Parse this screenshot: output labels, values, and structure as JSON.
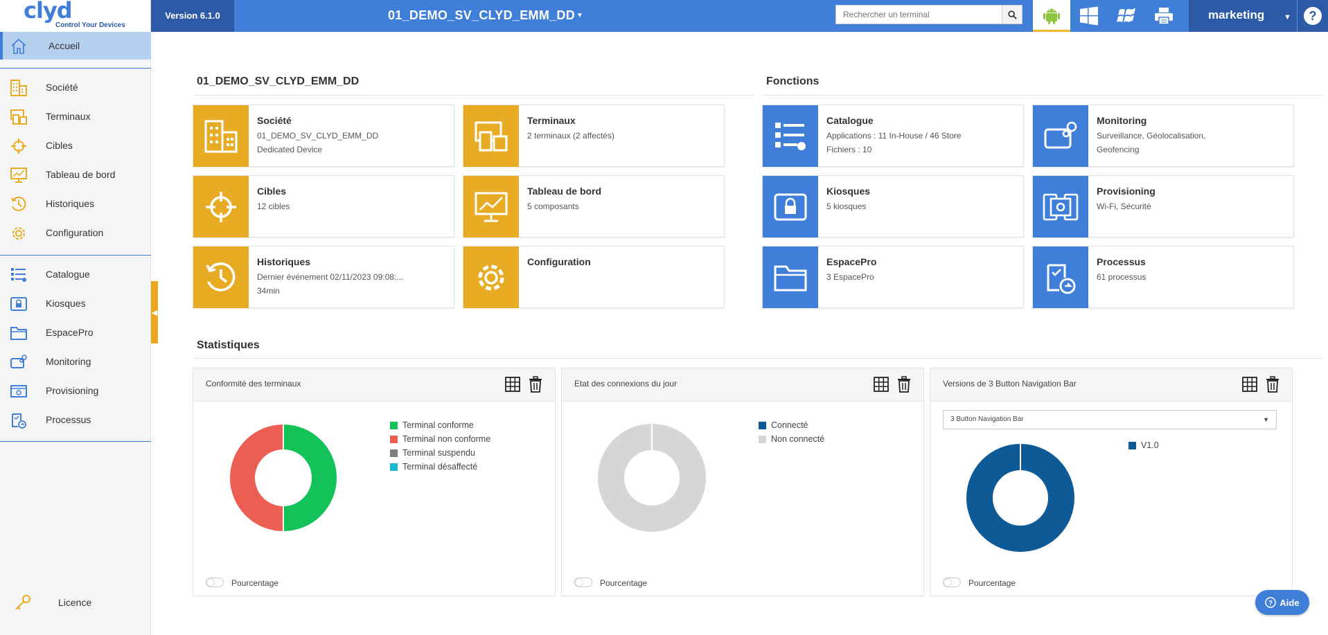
{
  "header": {
    "logo_text": "clyd",
    "logo_tagline": "Control Your Devices",
    "version": "Version 6.1.0",
    "company": "01_DEMO_SV_CLYD_EMM_DD",
    "search_placeholder": "Rechercher un terminal",
    "os_tabs": [
      {
        "icon": "android-icon",
        "active": true
      },
      {
        "icon": "windows-icon",
        "active": false
      },
      {
        "icon": "windows-phone-icon",
        "active": false
      },
      {
        "icon": "printer-icon",
        "active": false
      }
    ],
    "user": "marketing",
    "help_icon": "help-circle-icon"
  },
  "sidebar": {
    "home": "Accueil",
    "group1": [
      "Société",
      "Terminaux",
      "Cibles",
      "Tableau de bord",
      "Historiques",
      "Configuration"
    ],
    "group2": [
      "Catalogue",
      "Kiosques",
      "EspacePro",
      "Monitoring",
      "Provisioning",
      "Processus"
    ],
    "licence": "Licence"
  },
  "company_section": {
    "title": "01_DEMO_SV_CLYD_EMM_DD",
    "cards": [
      {
        "title": "Société",
        "line1": "01_DEMO_SV_CLYD_EMM_DD",
        "line2": "Dedicated Device"
      },
      {
        "title": "Terminaux",
        "line1": "2 terminaux (2 affectés)",
        "line2": ""
      },
      {
        "title": "Cibles",
        "line1": "12 cibles",
        "line2": ""
      },
      {
        "title": "Tableau de bord",
        "line1": "5 composants",
        "line2": ""
      },
      {
        "title": "Historiques",
        "line1": "Dernier événement 02/11/2023 09:08:...",
        "line2": "34min"
      },
      {
        "title": "Configuration",
        "line1": "",
        "line2": ""
      }
    ]
  },
  "functions_section": {
    "title": "Fonctions",
    "cards": [
      {
        "title": "Catalogue",
        "line1": "Applications : 11 In-House / 46 Store",
        "line2": "Fichiers : 10"
      },
      {
        "title": "Monitoring",
        "line1": "Surveillance, Géolocalisation,",
        "line2": "Geofencing"
      },
      {
        "title": "Kiosques",
        "line1": "5 kiosques",
        "line2": ""
      },
      {
        "title": "Provisioning",
        "line1": "Wi-Fi, Sécurité",
        "line2": ""
      },
      {
        "title": "EspacePro",
        "line1": "3 EspacePro",
        "line2": ""
      },
      {
        "title": "Processus",
        "line1": "61 processus",
        "line2": ""
      }
    ]
  },
  "stats_section": {
    "title": "Statistiques",
    "percentage_label": "Pourcentage",
    "select_value": "3 Button Navigation Bar"
  },
  "chart_data": [
    {
      "type": "pie",
      "title": "Conformité des terminaux",
      "categories": [
        "Terminal conforme",
        "Terminal non conforme",
        "Terminal suspendu",
        "Terminal désaffecté"
      ],
      "values": [
        1,
        1,
        0,
        0
      ],
      "colors": [
        "#14c25a",
        "#ec5e52",
        "#808080",
        "#1ab8cf"
      ],
      "legend": "right"
    },
    {
      "type": "pie",
      "title": "Etat des connexions du jour",
      "categories": [
        "Connecté",
        "Non connecté"
      ],
      "values": [
        0,
        2
      ],
      "colors": [
        "#0e5a96",
        "#d4d7d5"
      ],
      "legend": "right"
    },
    {
      "type": "pie",
      "title": "Versions de 3 Button Navigation Bar",
      "categories": [
        "V1.0"
      ],
      "values": [
        1
      ],
      "colors": [
        "#0e5a96"
      ],
      "legend": "right"
    }
  ],
  "aide_label": "Aide"
}
